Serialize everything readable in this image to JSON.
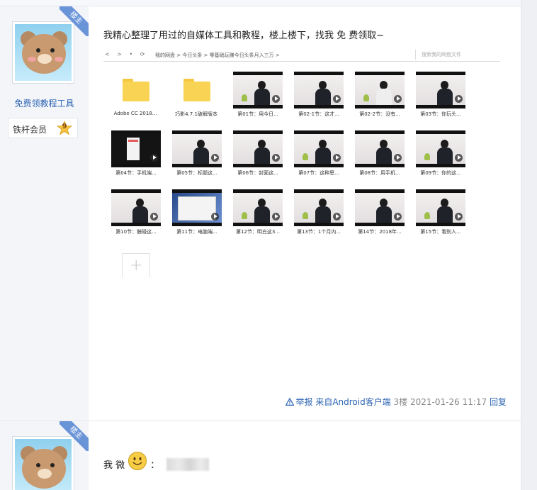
{
  "post1": {
    "floor_badge": "楼主",
    "author": {
      "name": "免费领教程工具",
      "badge_label": "铁杆会员",
      "level": "9"
    },
    "text": "我精心整理了用过的自媒体工具和教程，楼上楼下，找我 免 费领取~",
    "screenshot": {
      "nav_arrows": "< > • ⟳",
      "breadcrumb": "我的网盘  >  今日头条  >  零基础玩赚今日头条月入三万  >",
      "search_placeholder": "搜索我的网盘文件",
      "folders": [
        "Adobe CC 2018...",
        "巧影4.7.1破解版本"
      ],
      "videos": [
        "第01节：用今日...",
        "第02-1节：这才...",
        "第02-2节：没有...",
        "第03节：你玩头...",
        "第04节：手机端...",
        "第05节：标题这...",
        "第06节：封面这...",
        "第07节：这种思...",
        "第08节：用手机...",
        "第09节：你的这...",
        "第10节：触碰这...",
        "第11节：电脑端...",
        "第12节：明白这3...",
        "第13节：1个月内...",
        "第14节：2018年...",
        "第15节：看别人..."
      ],
      "add_symbol": "+"
    },
    "meta": {
      "report": "举报",
      "source": "来自Android客户端",
      "floor": "3楼",
      "timestamp": "2021-01-26 11:17",
      "reply": "回复"
    }
  },
  "post2": {
    "floor_badge": "楼主",
    "text_before": "我 微",
    "text_after": "："
  }
}
